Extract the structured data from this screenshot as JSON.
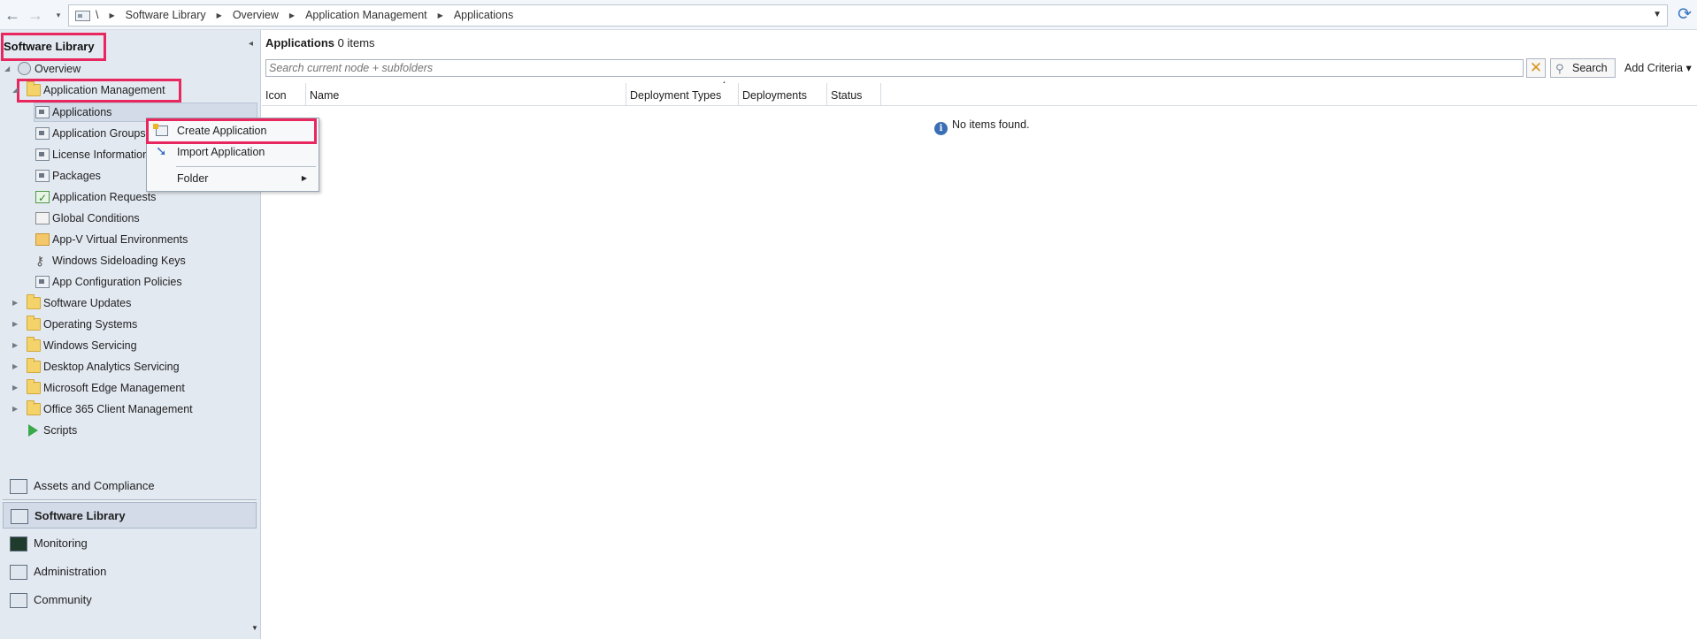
{
  "nav": {
    "back_icon": "←",
    "forward_icon": "→",
    "dropdown_icon": "▾",
    "refresh_icon": "⟳"
  },
  "address_bar": {
    "root": "\\",
    "crumbs": [
      "Software Library",
      "Overview",
      "Application Management",
      "Applications"
    ]
  },
  "left_pane": {
    "title": "Software Library",
    "collapse_icon": "◂",
    "tree": {
      "overview": "Overview",
      "application_management": "Application Management",
      "children": [
        "Applications",
        "Application Groups",
        "License Information",
        "Packages",
        "Application Requests",
        "Global Conditions",
        "App-V Virtual Environments",
        "Windows Sideloading Keys",
        "App Configuration Policies"
      ],
      "folders": [
        "Software Updates",
        "Operating Systems",
        "Windows Servicing",
        "Desktop Analytics Servicing",
        "Microsoft Edge Management",
        "Office 365 Client Management"
      ],
      "scripts": "Scripts"
    },
    "workspaces": [
      "Assets and Compliance",
      "Software Library",
      "Monitoring",
      "Administration",
      "Community"
    ],
    "active_workspace": "Software Library"
  },
  "main": {
    "list_title": "Applications",
    "item_count": "0 items",
    "search_placeholder": "Search current node + subfolders",
    "search_label": "Search",
    "add_criteria_label": "Add Criteria",
    "columns": [
      "Icon",
      "Name",
      "Deployment Types",
      "Deployments",
      "Status"
    ],
    "empty_message": "No items found."
  },
  "context_menu": {
    "items": [
      "Create Application",
      "Import Application",
      "Folder"
    ]
  },
  "colors": {
    "highlight": "#e8275f",
    "nav_bg": "#e3e9f1",
    "selected": "#d2dbe7"
  }
}
